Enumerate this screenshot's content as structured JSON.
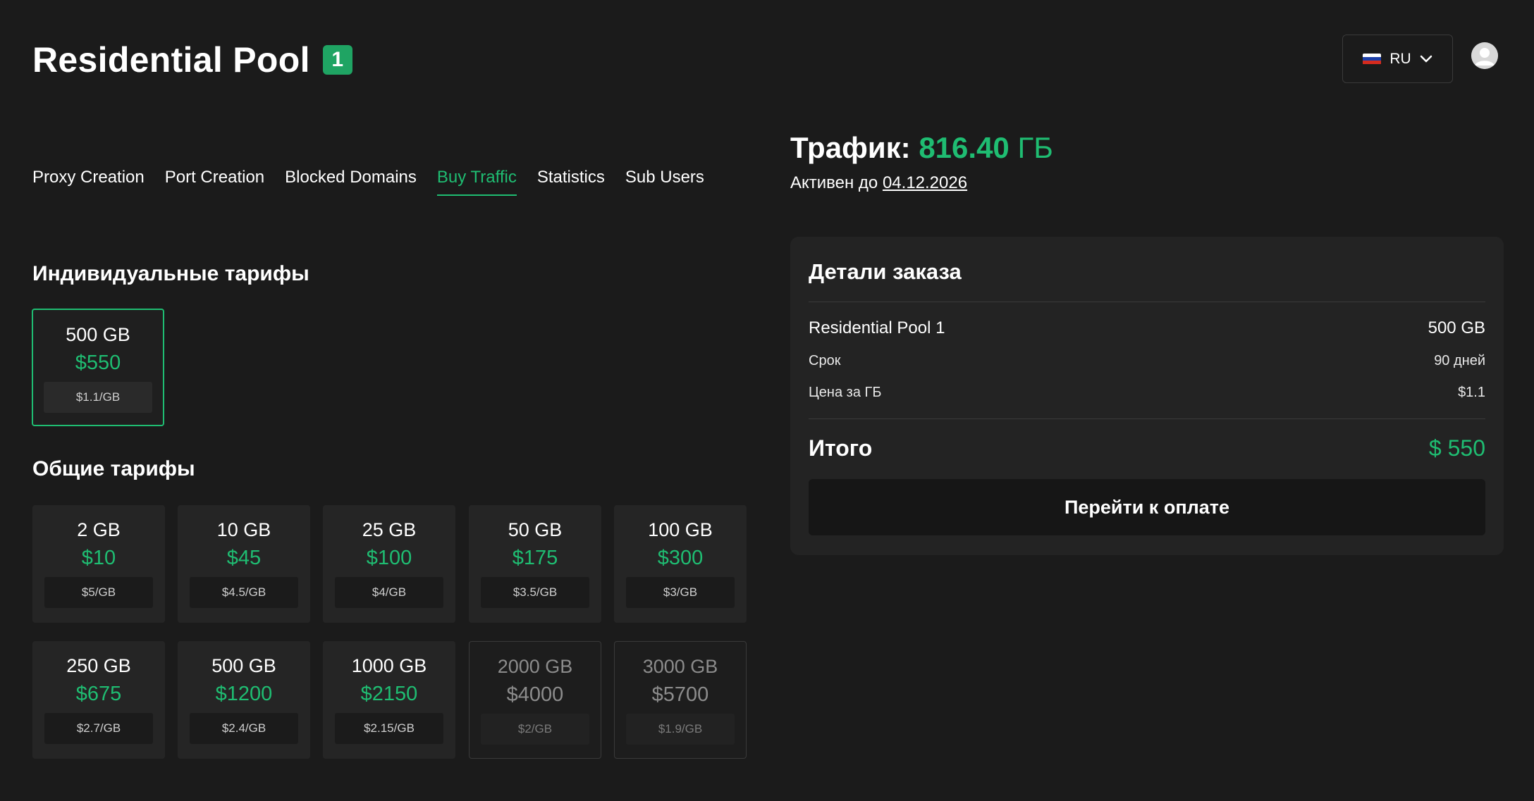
{
  "header": {
    "title": "Residential Pool",
    "badge": "1",
    "language": {
      "code": "RU",
      "flag_icon": "russia-flag-icon"
    },
    "avatar_icon": "user-avatar-icon"
  },
  "tabs": [
    {
      "label": "Proxy Creation",
      "active": false
    },
    {
      "label": "Port Creation",
      "active": false
    },
    {
      "label": "Blocked Domains",
      "active": false
    },
    {
      "label": "Buy Traffic",
      "active": true
    },
    {
      "label": "Statistics",
      "active": false
    },
    {
      "label": "Sub Users",
      "active": false
    }
  ],
  "individual": {
    "heading": "Индивидуальные тарифы",
    "plans": [
      {
        "gb": "500 GB",
        "price": "$550",
        "per_gb": "$1.1/GB",
        "selected": true
      }
    ]
  },
  "common": {
    "heading": "Общие тарифы",
    "plans": [
      {
        "gb": "2 GB",
        "price": "$10",
        "per_gb": "$5/GB",
        "disabled": false
      },
      {
        "gb": "10 GB",
        "price": "$45",
        "per_gb": "$4.5/GB",
        "disabled": false
      },
      {
        "gb": "25 GB",
        "price": "$100",
        "per_gb": "$4/GB",
        "disabled": false
      },
      {
        "gb": "50 GB",
        "price": "$175",
        "per_gb": "$3.5/GB",
        "disabled": false
      },
      {
        "gb": "100 GB",
        "price": "$300",
        "per_gb": "$3/GB",
        "disabled": false
      },
      {
        "gb": "250 GB",
        "price": "$675",
        "per_gb": "$2.7/GB",
        "disabled": false
      },
      {
        "gb": "500 GB",
        "price": "$1200",
        "per_gb": "$2.4/GB",
        "disabled": false
      },
      {
        "gb": "1000 GB",
        "price": "$2150",
        "per_gb": "$2.15/GB",
        "disabled": false
      },
      {
        "gb": "2000 GB",
        "price": "$4000",
        "per_gb": "$2/GB",
        "disabled": true
      },
      {
        "gb": "3000 GB",
        "price": "$5700",
        "per_gb": "$1.9/GB",
        "disabled": true
      }
    ]
  },
  "traffic": {
    "label": "Трафик:",
    "value": "816.40",
    "unit": "ГБ",
    "active_label": "Активен до",
    "active_date": "04.12.2026"
  },
  "order": {
    "title": "Детали заказа",
    "product_name": "Residential Pool 1",
    "product_amount": "500 GB",
    "term_label": "Срок",
    "term_value": "90 дней",
    "price_label": "Цена за ГБ",
    "price_value": "$1.1",
    "total_label": "Итого",
    "total_value": "$ 550",
    "pay_button": "Перейти к оплате"
  },
  "colors": {
    "accent": "#1fbd72",
    "badge": "#1fa463",
    "background": "#1b1b1b",
    "panel": "#232323",
    "card": "#252525"
  }
}
